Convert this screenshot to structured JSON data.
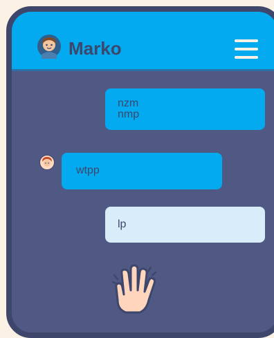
{
  "header": {
    "contact_name": "Marko",
    "avatar_icon": "user-avatar-icon",
    "menu_icon": "hamburger-menu-icon"
  },
  "messages": [
    {
      "direction": "outgoing",
      "lines": [
        "nzm",
        "nmp"
      ]
    },
    {
      "direction": "incoming",
      "text": "wtpp"
    },
    {
      "direction": "outgoing",
      "text": "lp"
    }
  ],
  "emoji": "waving-hand-icon",
  "colors": {
    "background": "#fbf1e5",
    "phone_frame": "#3e466c",
    "chat_bg": "#4f5983",
    "header": "#04aaef",
    "bubble_blue": "#04aaef",
    "bubble_light": "#d8ecf9",
    "text": "#3d476b"
  }
}
